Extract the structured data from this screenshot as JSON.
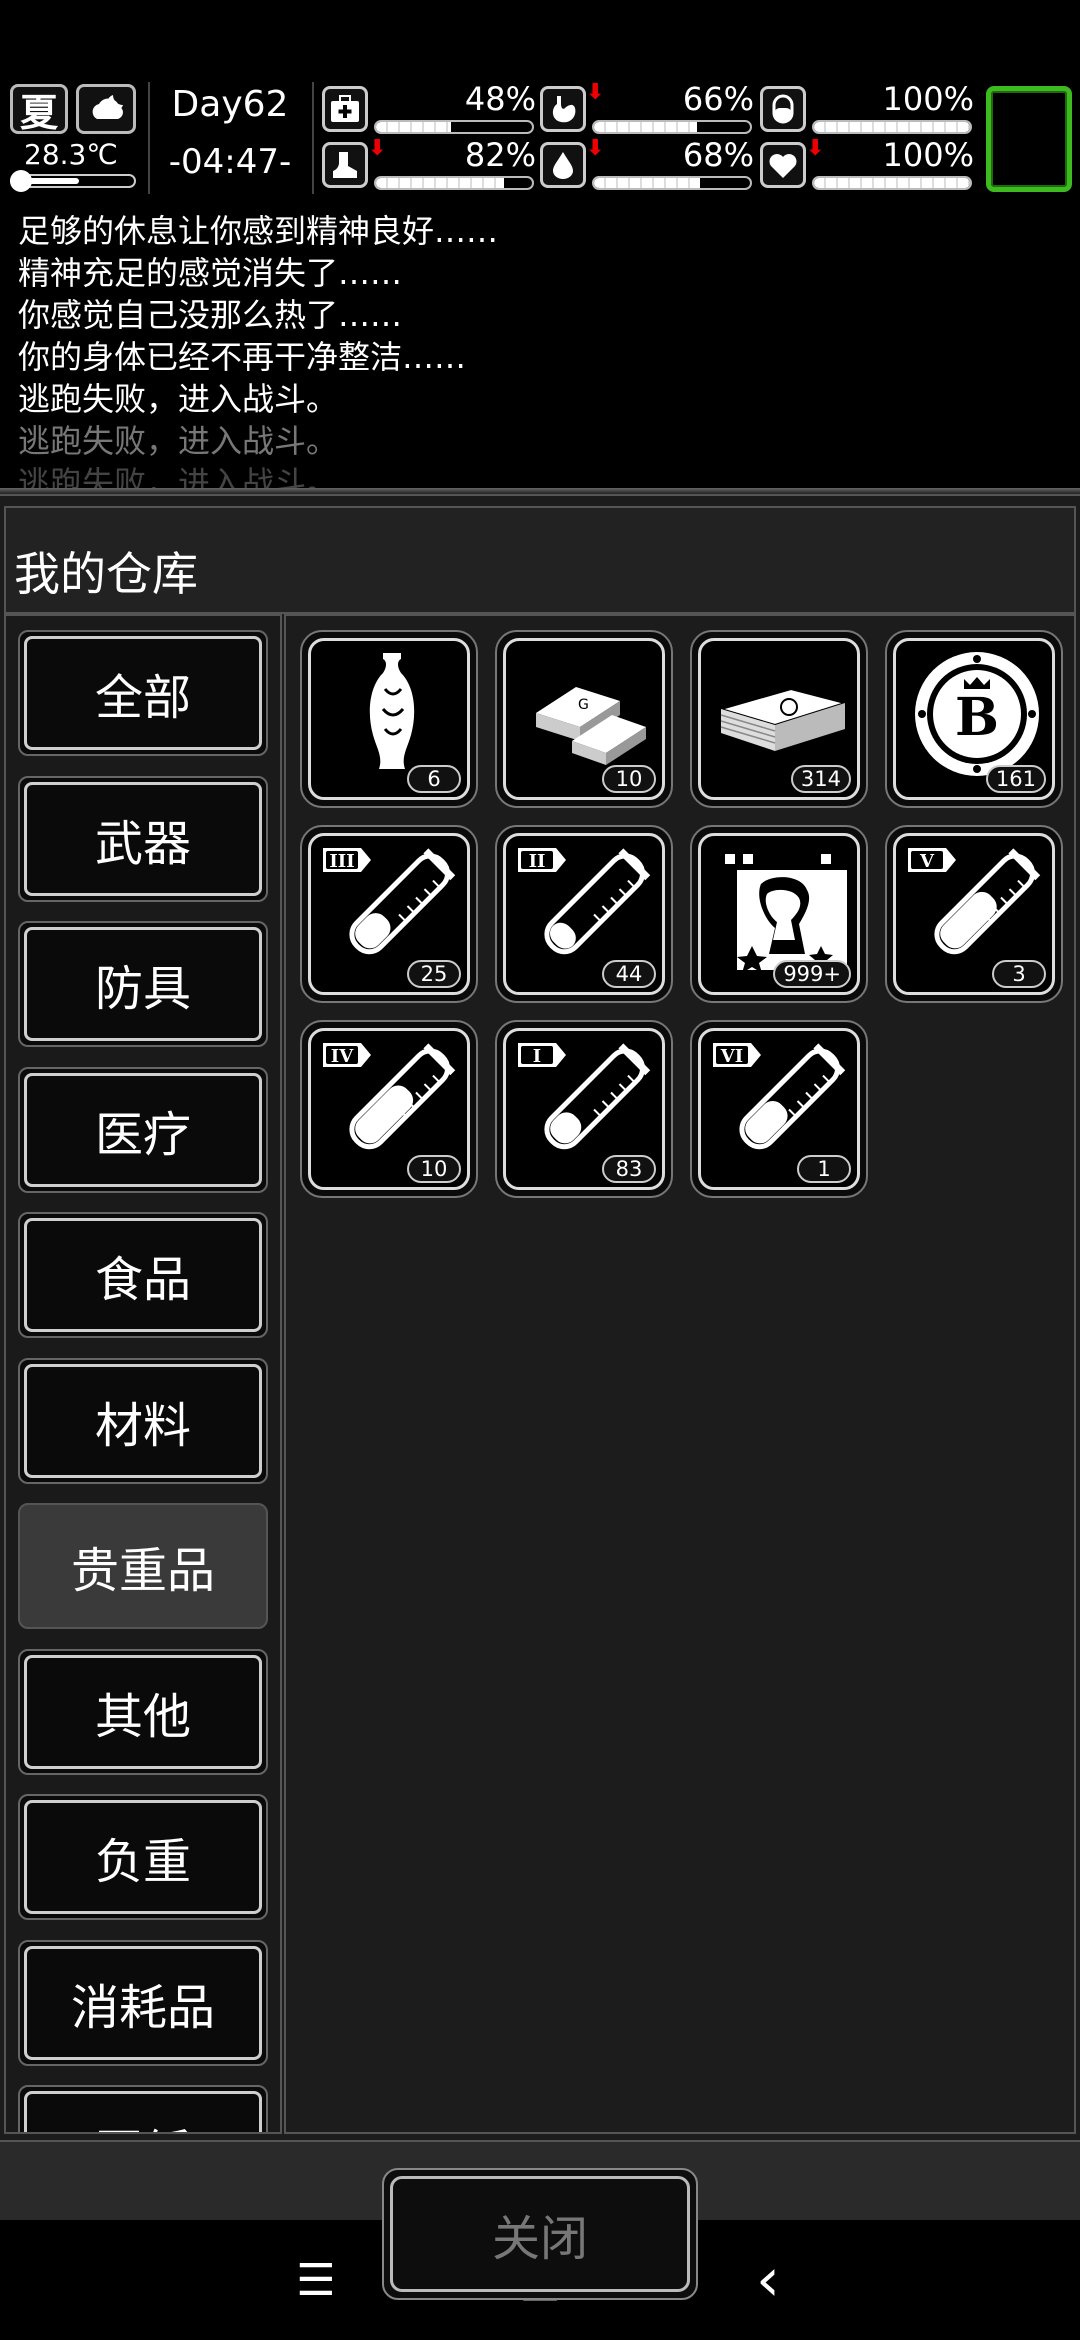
{
  "hud": {
    "season": "夏",
    "weather_icon": "cloudy-moon-icon",
    "temperature": "28.3℃",
    "temperature_level": 0.55,
    "day": "Day62",
    "time": "-04:47-",
    "stats": [
      {
        "name": "health",
        "icon": "medkit-icon",
        "value": "48%",
        "level": 0.48,
        "decreasing": false
      },
      {
        "name": "hunger",
        "icon": "stomach-icon",
        "value": "66%",
        "level": 0.66,
        "decreasing": true
      },
      {
        "name": "medicine",
        "icon": "pill-icon",
        "value": "100%",
        "level": 1.0,
        "decreasing": false
      },
      {
        "name": "stamina",
        "icon": "boot-icon",
        "value": "82%",
        "level": 0.82,
        "decreasing": true
      },
      {
        "name": "thirst",
        "icon": "water-drop-icon",
        "value": "68%",
        "level": 0.68,
        "decreasing": true
      },
      {
        "name": "mood",
        "icon": "heart-icon",
        "value": "100%",
        "level": 1.0,
        "decreasing": true
      }
    ],
    "accent_color": "#3dbb1e"
  },
  "log": [
    "足够的休息让你感到精神良好……",
    "精神充足的感觉消失了……",
    "你感觉自己没那么热了……",
    "你的身体已经不再干净整洁……",
    "逃跑失败，进入战斗。",
    "逃跑失败，进入战斗。",
    "逃跑失败，进入战斗。"
  ],
  "panel": {
    "title": "我的仓库",
    "categories": [
      "全部",
      "武器",
      "防具",
      "医疗",
      "食品",
      "材料",
      "贵重品",
      "其他",
      "负重",
      "消耗品",
      "图纸"
    ],
    "selected_category": "贵重品",
    "items": [
      {
        "icon": "vase-icon",
        "count": "6"
      },
      {
        "icon": "gold-bars-icon",
        "count": "10"
      },
      {
        "icon": "cash-stack-icon",
        "count": "314"
      },
      {
        "icon": "bitcoin-chip-icon",
        "count": "161"
      },
      {
        "icon": "test-tube-III-icon",
        "count": "25",
        "numeral": "III"
      },
      {
        "icon": "test-tube-II-icon",
        "count": "44",
        "numeral": "II"
      },
      {
        "icon": "zombie-card-icon",
        "count": "999+"
      },
      {
        "icon": "test-tube-V-icon",
        "count": "3",
        "numeral": "V"
      },
      {
        "icon": "test-tube-IV-icon",
        "count": "10",
        "numeral": "IV"
      },
      {
        "icon": "test-tube-I-icon",
        "count": "83",
        "numeral": "I"
      },
      {
        "icon": "test-tube-VI-icon",
        "count": "1",
        "numeral": "VI"
      }
    ],
    "close_label": "关闭"
  },
  "nav": {
    "menu": "☰",
    "home": "□",
    "back": "‹"
  }
}
